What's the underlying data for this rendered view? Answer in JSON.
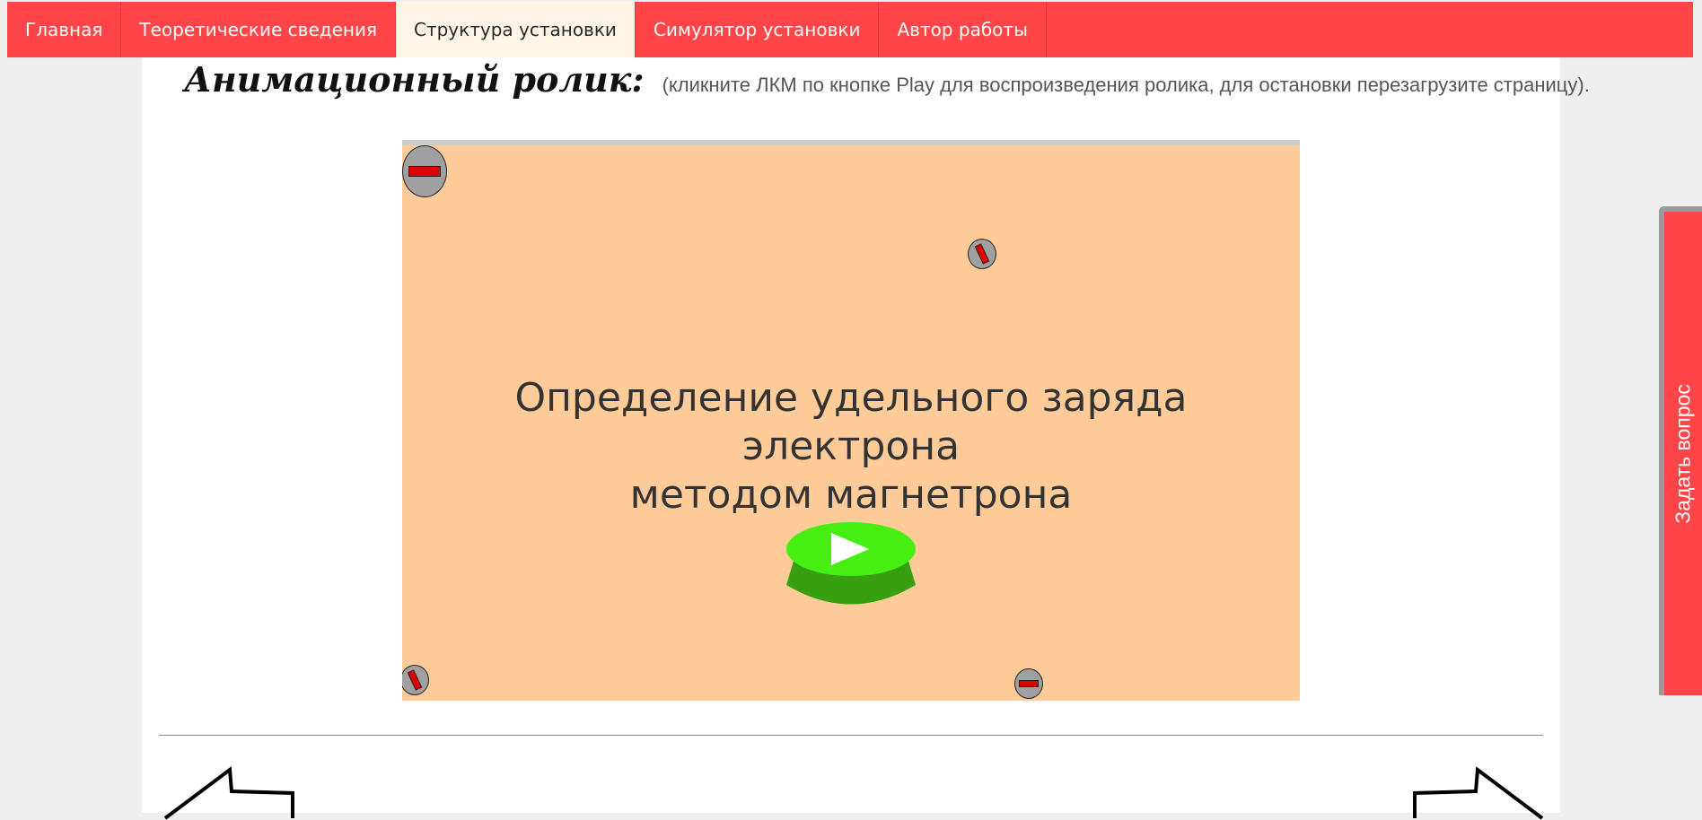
{
  "nav": {
    "items": [
      {
        "label": "Главная",
        "active": false
      },
      {
        "label": "Теоретические сведения",
        "active": false
      },
      {
        "label": "Структура установки",
        "active": true
      },
      {
        "label": "Симулятор установки",
        "active": false
      },
      {
        "label": "Автор работы",
        "active": false
      }
    ]
  },
  "main": {
    "heading": "Анимационный ролик:",
    "note": "(кликните ЛКМ по кнопке Play для воспроизведения ролика, для остановки перезагрузите страницу)."
  },
  "player": {
    "title_line1": "Определение удельного заряда электрона",
    "title_line2": "методом магнетрона",
    "play_icon": "play-icon",
    "background_color": "#ffcb98",
    "button_color": "#44ee11"
  },
  "side_tab": {
    "label": "Задать вопрос"
  },
  "colors": {
    "accent": "#ff4547",
    "active_tab": "#fff5e6"
  }
}
